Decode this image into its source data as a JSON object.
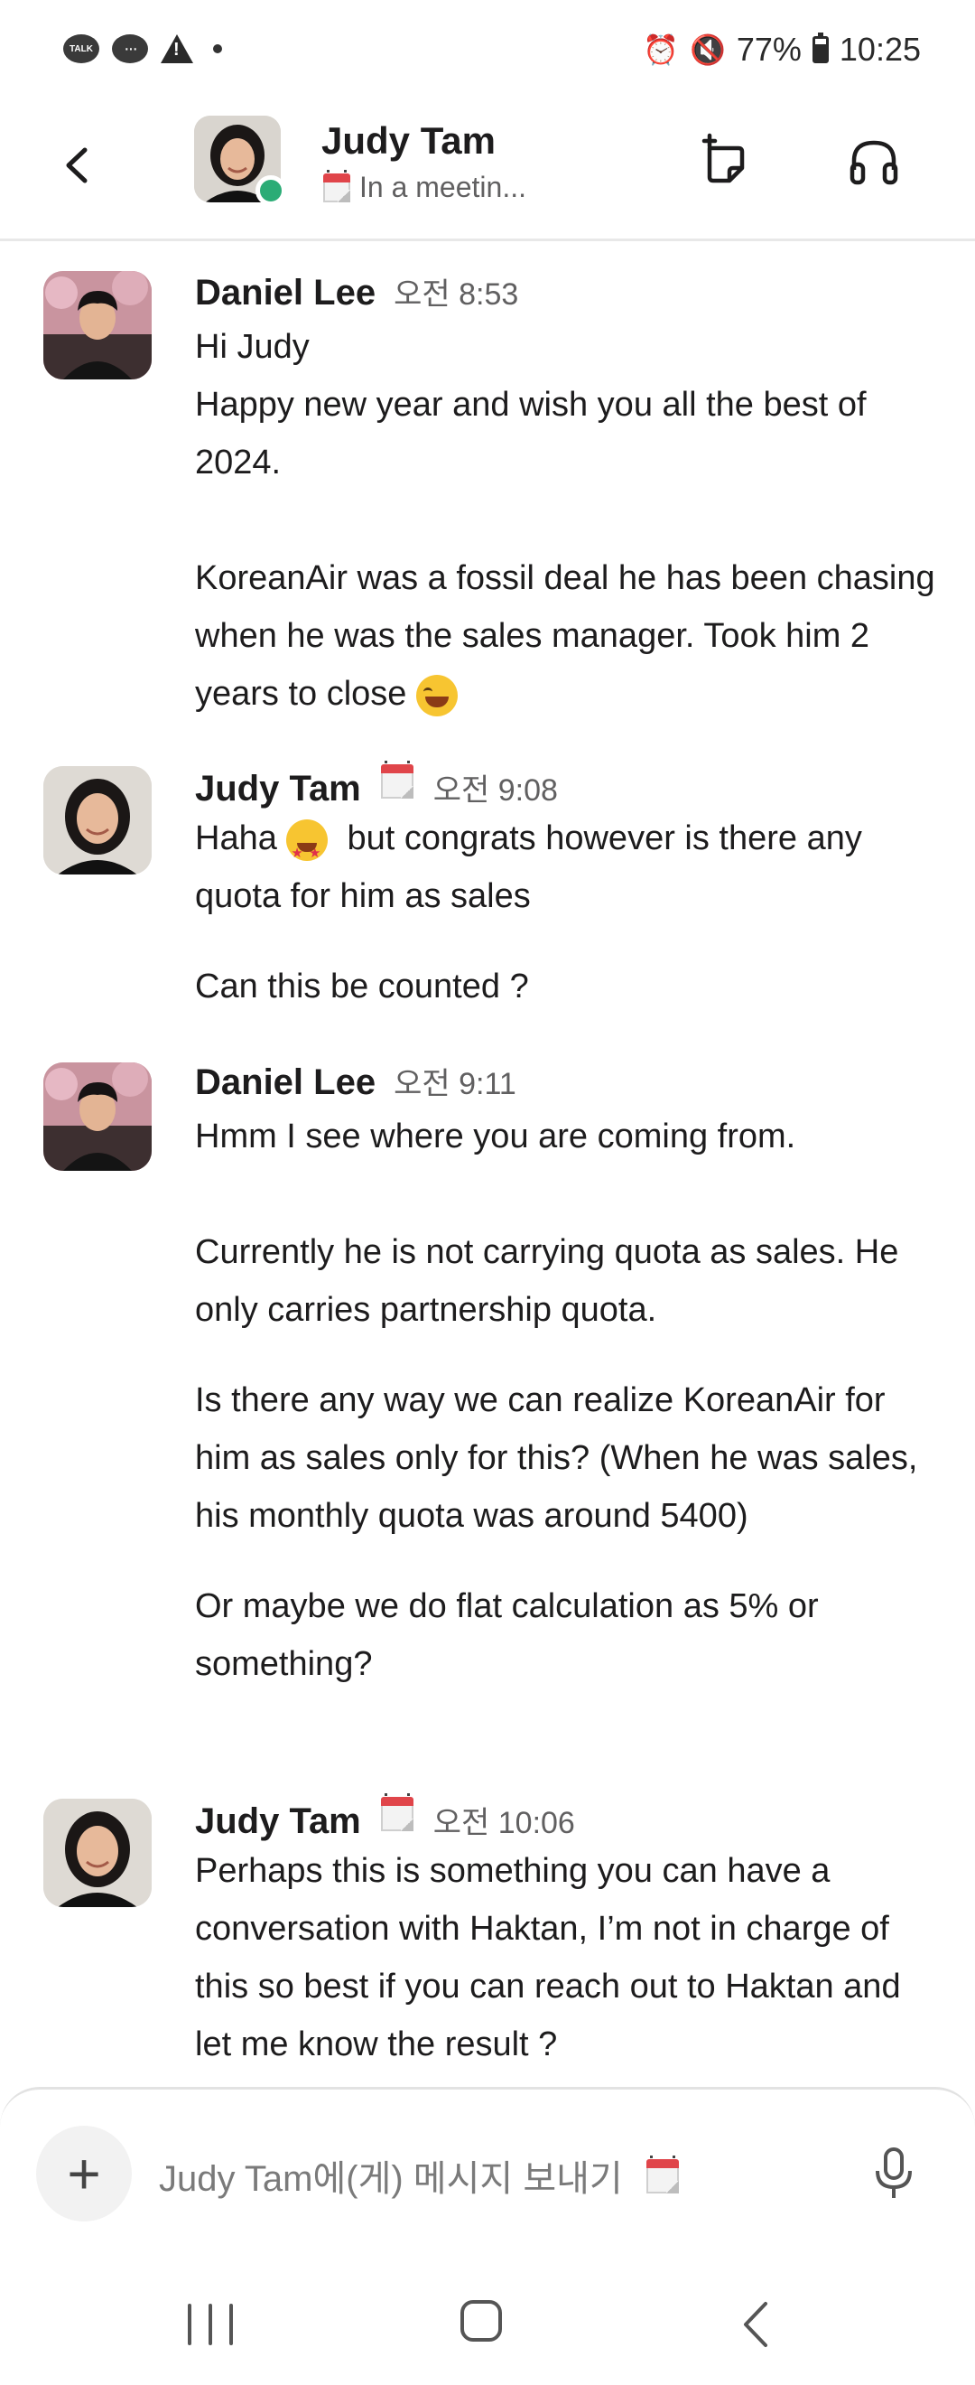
{
  "status_bar": {
    "talk_label": "TALK",
    "battery": "77%",
    "time": "10:25",
    "icons": [
      "kakaotalk-icon",
      "message-icon",
      "warning-icon",
      "dot-icon",
      "alarm-icon",
      "mute-icon",
      "battery-icon"
    ]
  },
  "header": {
    "name": "Judy Tam",
    "status": "In a meetin...",
    "presence": "active",
    "presence_color": "#2bac76"
  },
  "messages": [
    {
      "sender": "Daniel Lee",
      "time": "오전 8:53",
      "has_status_emoji": false,
      "paragraphs": [
        "Hi Judy\nHappy new year and wish you all the best of 2024.",
        "KoreanAir was a fossil deal he has been chasing when he was the sales manager. Took him 2 years to close"
      ]
    },
    {
      "sender": "Judy Tam",
      "time": "오전 9:08",
      "has_status_emoji": true,
      "paragraphs": [
        "Haha",
        "but congrats however is there any quota for him as sales",
        "Can this be counted ?"
      ]
    },
    {
      "sender": "Daniel Lee",
      "time": "오전 9:11",
      "has_status_emoji": false,
      "paragraphs": [
        "Hmm I see where you are coming from.",
        "Currently he is not carrying quota as sales. He only carries partnership quota.",
        "Is there any way we can realize KoreanAir for him as sales only for this? (When he was sales, his monthly quota was around 5400)",
        "Or maybe we do flat calculation as 5% or something?"
      ]
    },
    {
      "sender": "Judy Tam",
      "time": "오전 10:06",
      "has_status_emoji": true,
      "paragraphs": [
        "Perhaps this is something you can have a conversation with Haktan, I’m not in charge of this so best if you can reach out to Haktan and let me know the result ?"
      ]
    }
  ],
  "composer": {
    "placeholder": "Judy Tam에(게) 메시지 보내기"
  },
  "colors": {
    "accent_presence": "#2bac76",
    "text_primary": "#1d1c1d",
    "text_secondary": "#616061"
  }
}
